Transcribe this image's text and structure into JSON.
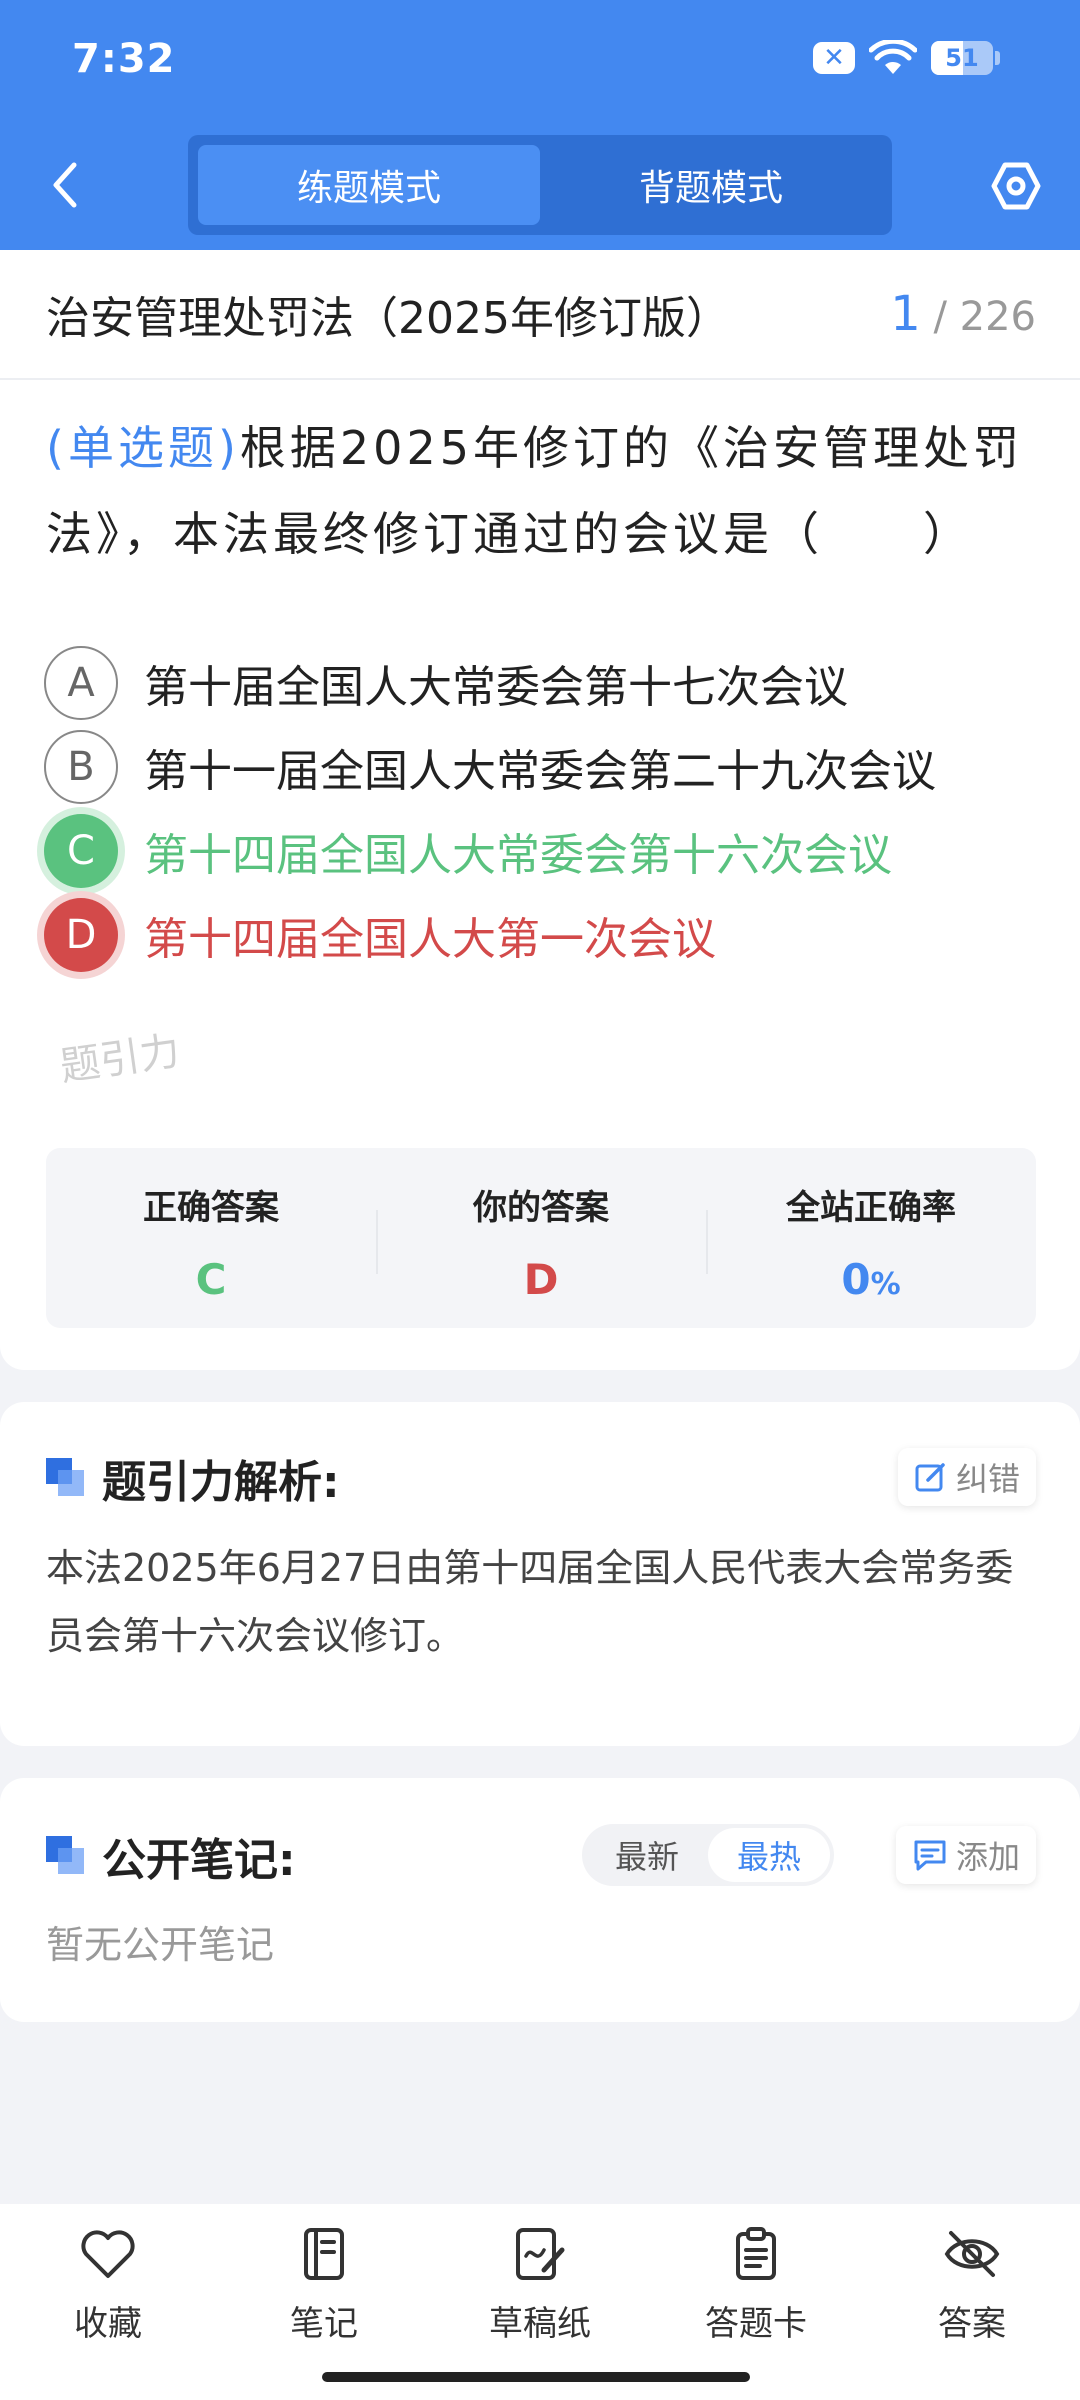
{
  "status_bar": {
    "time": "7:32",
    "battery": "51",
    "battery_level": 0.51,
    "notification_badge": "✕"
  },
  "header": {
    "tabs": [
      {
        "label": "练题模式",
        "active": true
      },
      {
        "label": "背题模式",
        "active": false
      }
    ]
  },
  "question": {
    "section_title": "治安管理处罚法（2025年修订版）",
    "current": "1",
    "total": "/ 226",
    "type": "(单选题)",
    "stem": "根据2025年修订的《治安管理处罚法》，本法最终修订通过的会议是（　　）",
    "options": [
      {
        "letter": "A",
        "text": "第十届全国人大常委会第十七次会议",
        "state": "normal"
      },
      {
        "letter": "B",
        "text": "第十一届全国人大常委会第二十九次会议",
        "state": "normal"
      },
      {
        "letter": "C",
        "text": "第十四届全国人大常委会第十六次会议",
        "state": "correct"
      },
      {
        "letter": "D",
        "text": "第十四届全国人大第一次会议",
        "state": "wrong"
      }
    ]
  },
  "answer_summary": {
    "correct_label": "正确答案",
    "correct_value": "C",
    "yours_label": "你的答案",
    "yours_value": "D",
    "rate_label": "全站正确率",
    "rate_value": "0",
    "rate_unit": "%",
    "watermark": "题引力"
  },
  "analysis": {
    "title": "题引力解析:",
    "report_label": "纠错",
    "text": "本法2025年6月27日由第十四届全国人民代表大会常务委员会第十六次会议修订。"
  },
  "notes": {
    "title": "公开笔记:",
    "sort_options": [
      {
        "label": "最新",
        "active": false
      },
      {
        "label": "最热",
        "active": true
      }
    ],
    "add_label": "添加",
    "empty_text": "暂无公开笔记"
  },
  "bottom_bar": {
    "items": [
      {
        "label": "收藏",
        "icon": "heart-icon"
      },
      {
        "label": "笔记",
        "icon": "notebook-icon"
      },
      {
        "label": "草稿纸",
        "icon": "draft-icon"
      },
      {
        "label": "答题卡",
        "icon": "answer-card-icon"
      },
      {
        "label": "答案",
        "icon": "eye-off-icon"
      }
    ]
  },
  "colors": {
    "primary": "#4388f0",
    "correct": "#5ac27f",
    "wrong": "#d34a4a"
  }
}
